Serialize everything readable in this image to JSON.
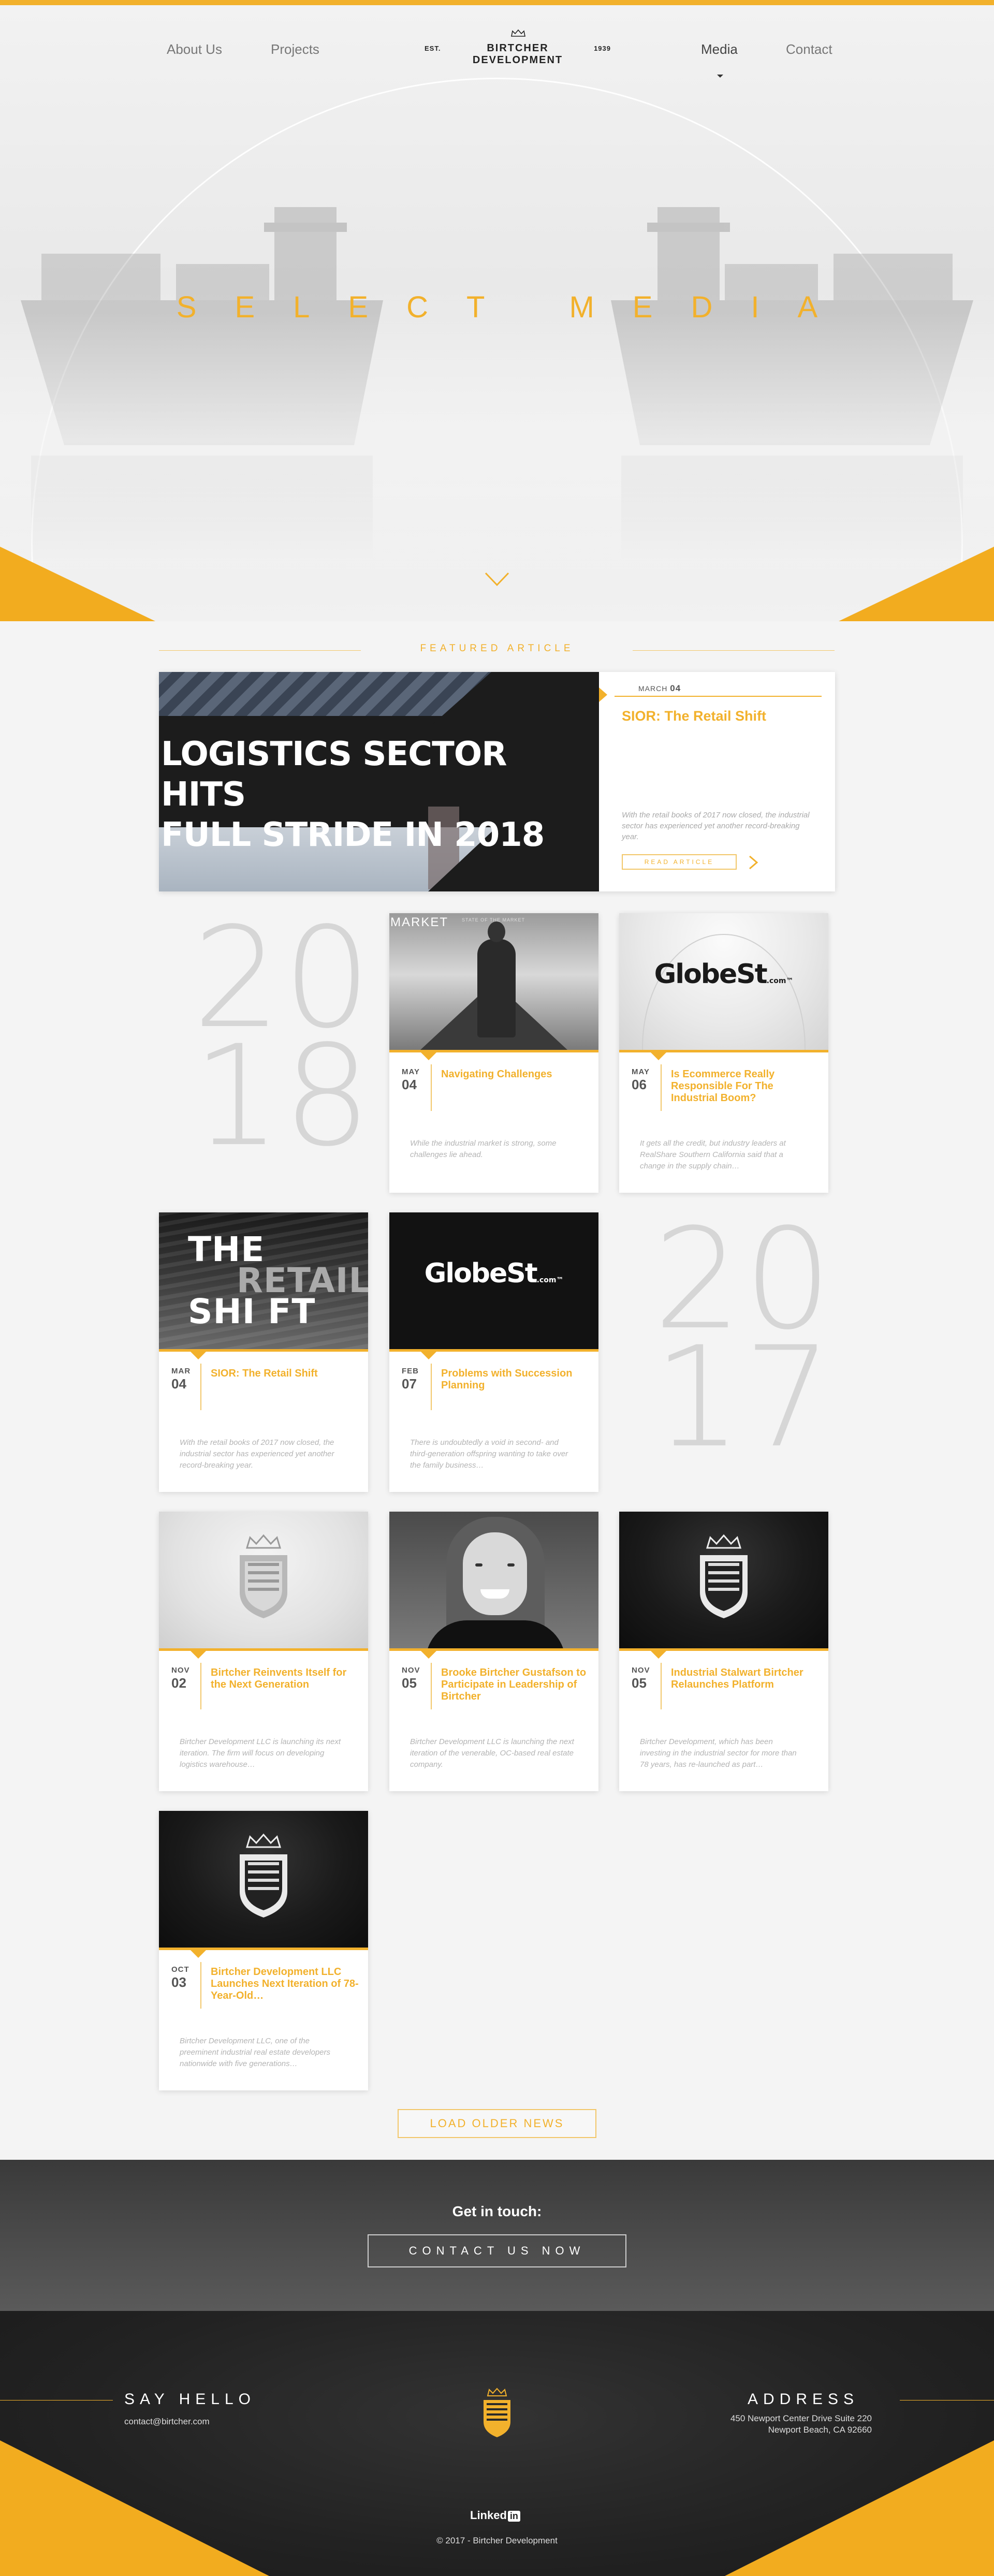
{
  "nav": {
    "about": "About Us",
    "projects": "Projects",
    "media": "Media",
    "contact": "Contact",
    "logo_est": "EST.",
    "logo_name": "BIRTCHER DEVELOPMENT",
    "logo_year": "1939"
  },
  "hero": {
    "title": "SELECT MEDIA"
  },
  "featured": {
    "section_label": "FEATURED ARTICLE",
    "image_headline_1": "LOGISTICS SECTOR HITS",
    "image_headline_2": "FULL STRIDE IN 2018",
    "month": "MARCH",
    "day": "04",
    "title": "SIOR: The Retail Shift",
    "excerpt": "With the retail books of 2017 now closed, the industrial sector has experienced yet another record-breaking year.",
    "button": "READ ARTICLE"
  },
  "years": {
    "y2018": [
      "20",
      "18"
    ],
    "y2017": [
      "20",
      "17"
    ]
  },
  "cards": [
    {
      "month": "MAY",
      "day": "04",
      "title": "Navigating Challenges",
      "excerpt": "While the industrial market is strong, some challenges lie ahead.",
      "image_label": "MARKET",
      "image_sub": "STATE OF THE MARKET"
    },
    {
      "month": "MAY",
      "day": "06",
      "title": "Is Ecommerce Really Responsible For The Industrial Boom?",
      "excerpt": "It gets all the credit, but industry leaders at RealShare Southern California said that a change in the supply chain…",
      "image_text": "GlobeSt",
      "image_suffix": ".com™"
    },
    {
      "month": "MAR",
      "day": "04",
      "title": "SIOR: The Retail Shift",
      "excerpt": "With the retail books of 2017 now closed, the industrial sector has experienced yet another record-breaking year.",
      "image_t1": "THE",
      "image_t2": "RETAIL",
      "image_t3": "SHI FT"
    },
    {
      "month": "FEB",
      "day": "07",
      "title": "Problems with Succession Planning",
      "excerpt": "There is undoubtedly a void in second- and third-generation offspring wanting to take over the family business…",
      "image_text": "GlobeSt",
      "image_suffix": ".com™"
    },
    {
      "month": "NOV",
      "day": "02",
      "title": "Birtcher Reinvents Itself for the Next Generation",
      "excerpt": "Birtcher Development LLC is launching its next iteration. The firm will focus on developing logistics warehouse…"
    },
    {
      "month": "NOV",
      "day": "05",
      "title": "Brooke Birtcher Gustafson to Participate in Leadership of Birtcher",
      "excerpt": "Birtcher Development LLC is launching the next iteration of the venerable, OC-based real estate company."
    },
    {
      "month": "NOV",
      "day": "05",
      "title": "Industrial Stalwart Birtcher Relaunches Platform",
      "excerpt": "Birtcher Development, which has been investing in the industrial sector for more than 78 years, has re-launched as part…"
    },
    {
      "month": "OCT",
      "day": "03",
      "title": "Birtcher Development LLC Launches Next Iteration of 78-Year-Old…",
      "excerpt": "Birtcher Development LLC, one of the preeminent industrial real estate developers nationwide with five generations…"
    }
  ],
  "load_more": "LOAD OLDER NEWS",
  "touch": {
    "title": "Get in touch:",
    "button": "CONTACT US NOW"
  },
  "footer": {
    "say_hello": "SAY HELLO",
    "email": "contact@birtcher.com",
    "address_heading": "ADDRESS",
    "address_line1": "450 Newport Center Drive Suite 220",
    "address_line2": "Newport Beach, CA 92660",
    "linkedin": "Linked",
    "linkedin_in": "in",
    "copyright": "© 2017 - Birtcher Development"
  },
  "colors": {
    "accent": "#f2b12c",
    "dark": "#222222",
    "background": "#f4f4f4"
  }
}
